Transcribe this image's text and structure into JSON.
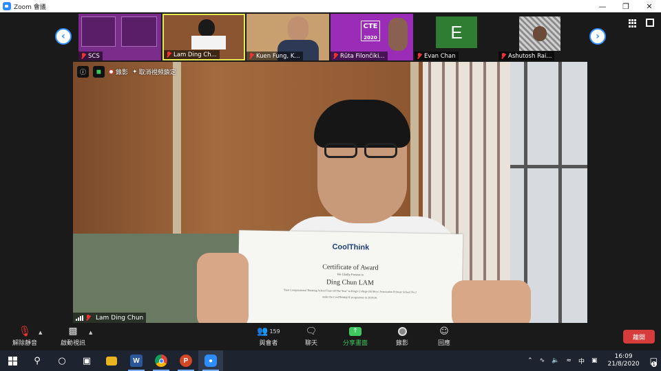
{
  "window": {
    "title": "Zoom 會議",
    "controls": [
      "minimize-icon",
      "restore-icon",
      "close-icon"
    ]
  },
  "gallery": {
    "participants": [
      {
        "name": "SCS",
        "muted": true
      },
      {
        "name": "Lam Ding Ch...",
        "muted": true
      },
      {
        "name": "Kuen Fung, K...",
        "muted": true
      },
      {
        "name": "Rūta Filončiki...",
        "muted": true
      },
      {
        "name": "Evan Chan",
        "muted": true,
        "avatar_letter": "E",
        "avatar_color": "#2e7d32"
      },
      {
        "name": "Ashutosh Rai...",
        "muted": true
      }
    ],
    "thumb_labels": {
      "cte": "CTE",
      "cte_year": "2020"
    }
  },
  "main_video": {
    "recording_label": "錄影",
    "unpin_label": "取消視頻鎖定",
    "speaker_name": "Lam Ding Chun",
    "certificate": {
      "org": "CoolThink",
      "heading": "Certificate of Award",
      "subtitle": "We Gladly Present to",
      "name": "Ding Chun LAM",
      "detail": "\"Best Computational Thinking School Team Of The Year\" in King's College Old Boys' Association Primary School No.2",
      "detail2": "under the CoolThink@JC programme in 2019/20."
    }
  },
  "toolbar": {
    "unmute": "解除靜音",
    "start_video": "啟動視訊",
    "participants": "與會者",
    "participants_count": "159",
    "chat": "聊天",
    "share": "分享畫面",
    "record": "錄影",
    "reactions": "回應",
    "end": "離開",
    "share_color": "#3ec95f",
    "end_color": "#d63c3c"
  },
  "taskbar": {
    "apps": [
      "windows-start",
      "search",
      "cortana",
      "task-view",
      "file-explorer",
      "word",
      "chrome",
      "powerpoint",
      "zoom"
    ],
    "tray": {
      "ime": "中",
      "time": "16:09",
      "date": "21/8/2020",
      "notifications": "1"
    }
  }
}
